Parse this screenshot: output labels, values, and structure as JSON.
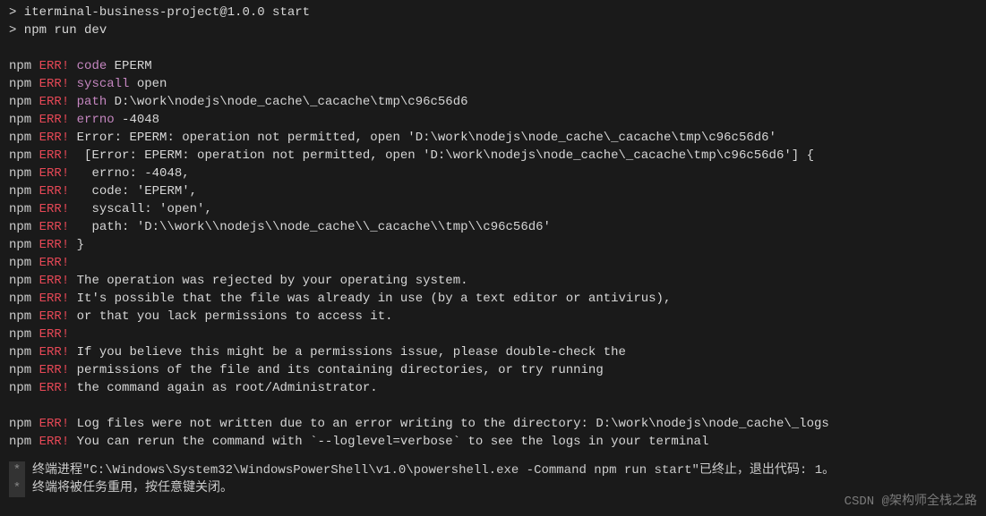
{
  "prompt1": "> iterminal-business-project@1.0.0 start",
  "prompt2": "> npm run dev",
  "prefix_npm": "npm",
  "prefix_err": "ERR!",
  "lines": {
    "l1_key": "code",
    "l1_val": " EPERM",
    "l2_key": "syscall",
    "l2_val": " open",
    "l3_key": "path",
    "l3_val": " D:\\work\\nodejs\\node_cache\\_cacache\\tmp\\c96c56d6",
    "l4_key": "errno",
    "l4_val": " -4048",
    "l5": " Error: EPERM: operation not permitted, open 'D:\\work\\nodejs\\node_cache\\_cacache\\tmp\\c96c56d6'",
    "l6": "  [Error: EPERM: operation not permitted, open 'D:\\work\\nodejs\\node_cache\\_cacache\\tmp\\c96c56d6'] {",
    "l7": "   errno: -4048,",
    "l8": "   code: 'EPERM',",
    "l9": "   syscall: 'open',",
    "l10": "   path: 'D:\\\\work\\\\nodejs\\\\node_cache\\\\_cacache\\\\tmp\\\\c96c56d6'",
    "l11": " }",
    "l12": "",
    "l13": " The operation was rejected by your operating system.",
    "l14": " It's possible that the file was already in use (by a text editor or antivirus),",
    "l15": " or that you lack permissions to access it.",
    "l16": "",
    "l17": " If you believe this might be a permissions issue, please double-check the",
    "l18": " permissions of the file and its containing directories, or try running",
    "l19": " the command again as root/Administrator.",
    "l20": " Log files were not written due to an error writing to the directory: D:\\work\\nodejs\\node_cache\\_logs",
    "l21": " You can rerun the command with `--loglevel=verbose` to see the logs in your terminal"
  },
  "footer1": "终端进程\"C:\\Windows\\System32\\WindowsPowerShell\\v1.0\\powershell.exe -Command npm run start\"已终止，退出代码: 1。",
  "footer2": "终端将被任务重用，按任意键关闭。",
  "watermark": "CSDN @架构师全栈之路"
}
